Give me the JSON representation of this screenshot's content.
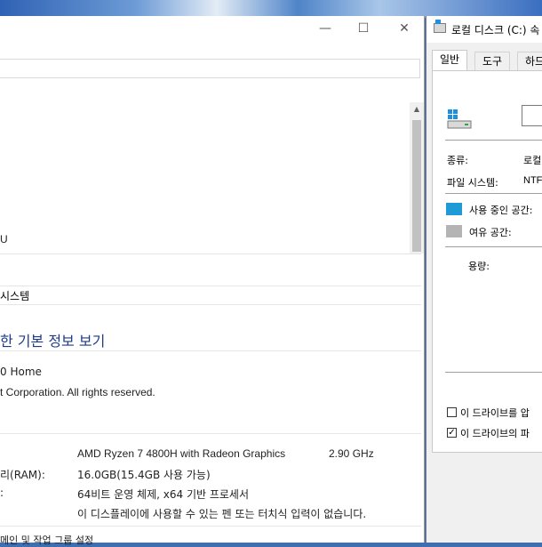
{
  "system_window": {
    "title_controls": {
      "minimize": "—",
      "maximize": "☐",
      "close": "✕"
    },
    "upper_pane_text": "U",
    "breadcrumb": "시스템",
    "heading": "한 기본 정보 보기",
    "edition": "0 Home",
    "copyright": "t Corporation. All rights reserved.",
    "specs": [
      {
        "label": "",
        "value": "AMD Ryzen 7 4800H with Radeon Graphics",
        "extra": "2.90 GHz"
      },
      {
        "label": "리(RAM):",
        "value": "16.0GB(15.4GB 사용 가능)",
        "extra": ""
      },
      {
        "label": ":",
        "value": "64비트 운영 체제, x64 기반 프로세서",
        "extra": ""
      },
      {
        "label": "",
        "value": "이 디스플레이에 사용할 수 있는 펜 또는 터치식 입력이 없습니다.",
        "extra": ""
      }
    ],
    "footer_fragment": "메인 및 작업 그룹 설정"
  },
  "properties": {
    "title": "로컬 디스크 (C:) 속",
    "tabs": [
      "일반",
      "도구",
      "하드"
    ],
    "name_value": "",
    "type_label": "종류:",
    "type_value": "로컬",
    "fs_label": "파일 시스템:",
    "fs_value": "NTFS",
    "used_label": "사용 중인 공간:",
    "free_label": "여유 공간:",
    "capacity_label": "용량:",
    "compress_label": "이 드라이브를 압",
    "index_label": "이 드라이브의 파",
    "colors": {
      "used": "#1f9ad6",
      "free": "#b4b4b4"
    }
  }
}
